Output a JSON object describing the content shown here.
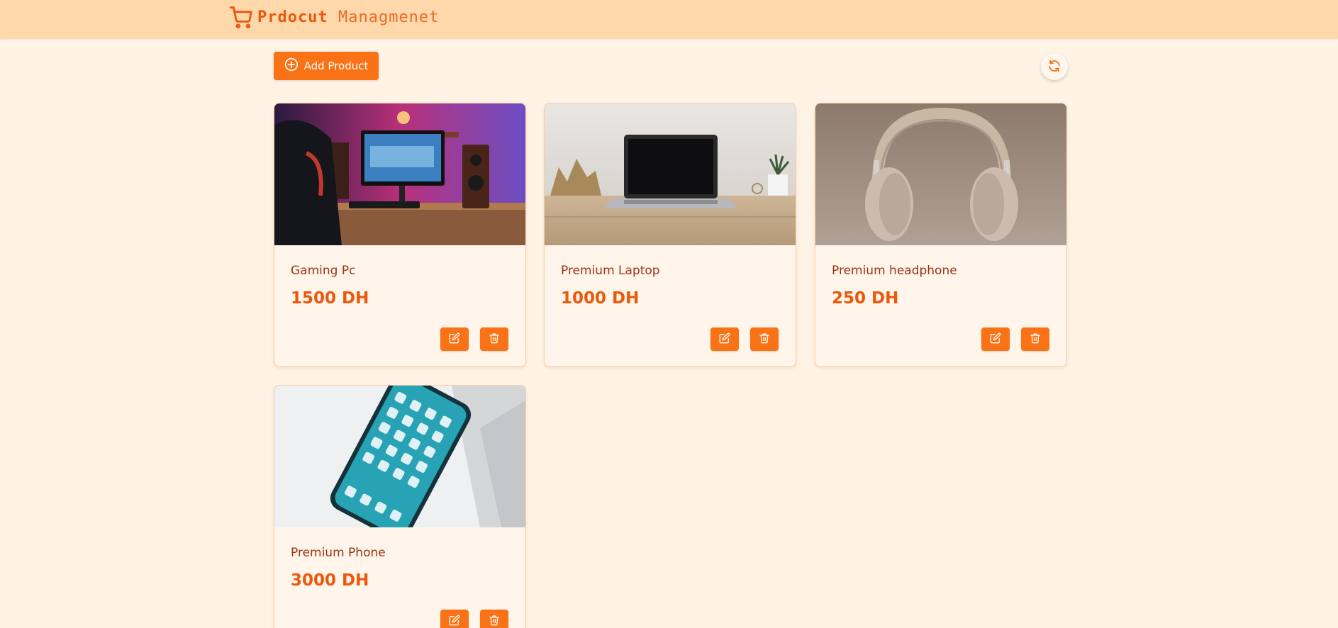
{
  "header": {
    "title_part1": "Prdocut",
    "title_part2": "Managmenet",
    "logo_icon": "shopping-cart-icon"
  },
  "toolbar": {
    "add_label": "Add Product",
    "add_icon": "plus-circle-icon",
    "refresh_icon": "refresh-icon"
  },
  "products": [
    {
      "name": "Gaming Pc",
      "price": "1500 DH",
      "image": "gaming-pc-photo"
    },
    {
      "name": "Premium Laptop",
      "price": "1000 DH",
      "image": "laptop-photo"
    },
    {
      "name": "Premium headphone",
      "price": "250 DH",
      "image": "headphone-photo"
    },
    {
      "name": "Premium Phone",
      "price": "3000 DH",
      "image": "phone-photo"
    }
  ],
  "colors": {
    "accent": "#f97316",
    "header_bg": "#fed7aa",
    "page_bg": "#fff3e6",
    "title_color": "#ea580c",
    "name_color": "#9a3412"
  }
}
